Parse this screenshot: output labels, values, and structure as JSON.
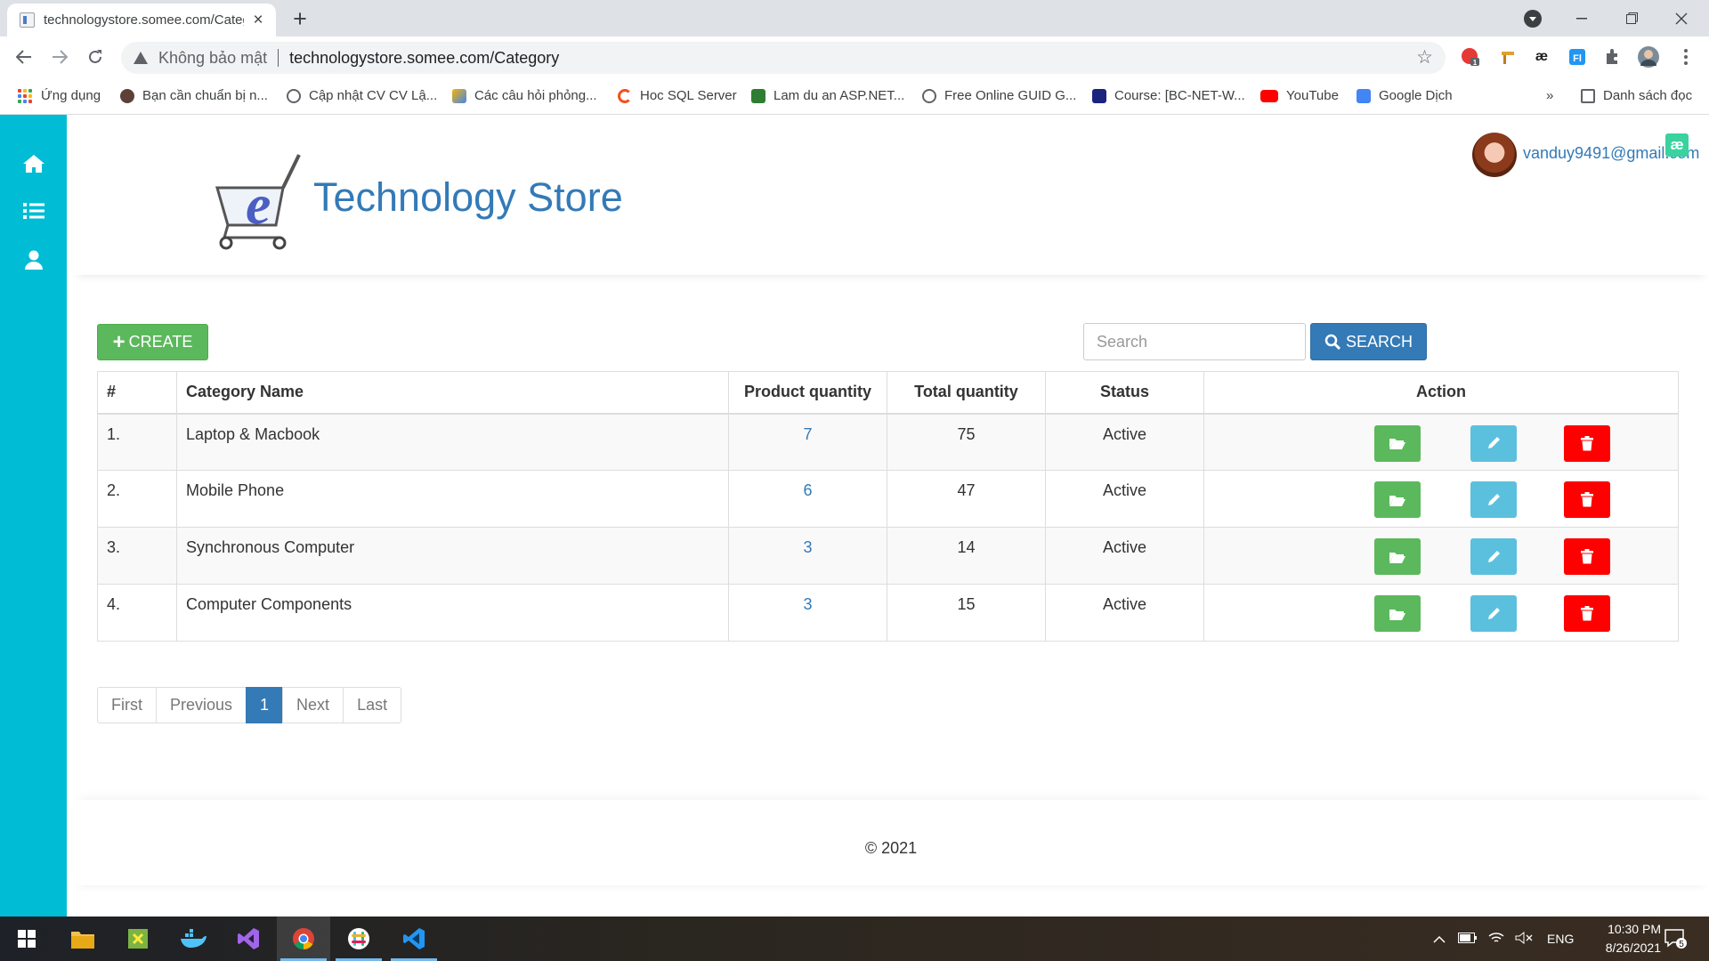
{
  "browser": {
    "tab_title": "technologystore.somee.com/Category",
    "security_label": "Không bảo mật",
    "url": "technologystore.somee.com/Category",
    "bookmarks": [
      {
        "label": "Ứng dụng"
      },
      {
        "label": "Bạn cần chuẩn bị n..."
      },
      {
        "label": "Cập nhật CV CV Lậ..."
      },
      {
        "label": "Các câu hỏi phỏng..."
      },
      {
        "label": "Hoc SQL Server"
      },
      {
        "label": "Lam du an ASP.NET..."
      },
      {
        "label": "Free Online GUID G..."
      },
      {
        "label": "Course: [BC-NET-W..."
      },
      {
        "label": "YouTube"
      },
      {
        "label": "Google Dịch"
      }
    ],
    "overflow_label": "»",
    "reading_list": "Danh sách đọc"
  },
  "header": {
    "brand": "Technology Store",
    "user_email": "vanduy9491@gmail.com",
    "ae_badge": "æ"
  },
  "toolbar": {
    "create_label": "CREATE",
    "search_placeholder": "Search",
    "search_label": "SEARCH"
  },
  "table": {
    "columns": [
      "#",
      "Category Name",
      "Product quantity",
      "Total quantity",
      "Status",
      "Action"
    ],
    "rows": [
      {
        "num": "1.",
        "name": "Laptop & Macbook",
        "product_qty": "7",
        "total_qty": "75",
        "status": "Active"
      },
      {
        "num": "2.",
        "name": "Mobile Phone",
        "product_qty": "6",
        "total_qty": "47",
        "status": "Active"
      },
      {
        "num": "3.",
        "name": "Synchronous Computer",
        "product_qty": "3",
        "total_qty": "14",
        "status": "Active"
      },
      {
        "num": "4.",
        "name": "Computer Components",
        "product_qty": "3",
        "total_qty": "15",
        "status": "Active"
      }
    ]
  },
  "pagination": {
    "first": "First",
    "previous": "Previous",
    "current": "1",
    "next": "Next",
    "last": "Last"
  },
  "footer": {
    "copyright": "© 2021"
  },
  "taskbar": {
    "language": "ENG",
    "time": "10:30 PM",
    "date": "8/26/2021",
    "notifications": "5"
  },
  "colors": {
    "sidebar": "#00bcd4",
    "primary": "#337ab7",
    "success": "#5cb85c",
    "info": "#5bc0de",
    "danger": "#ff0000"
  }
}
